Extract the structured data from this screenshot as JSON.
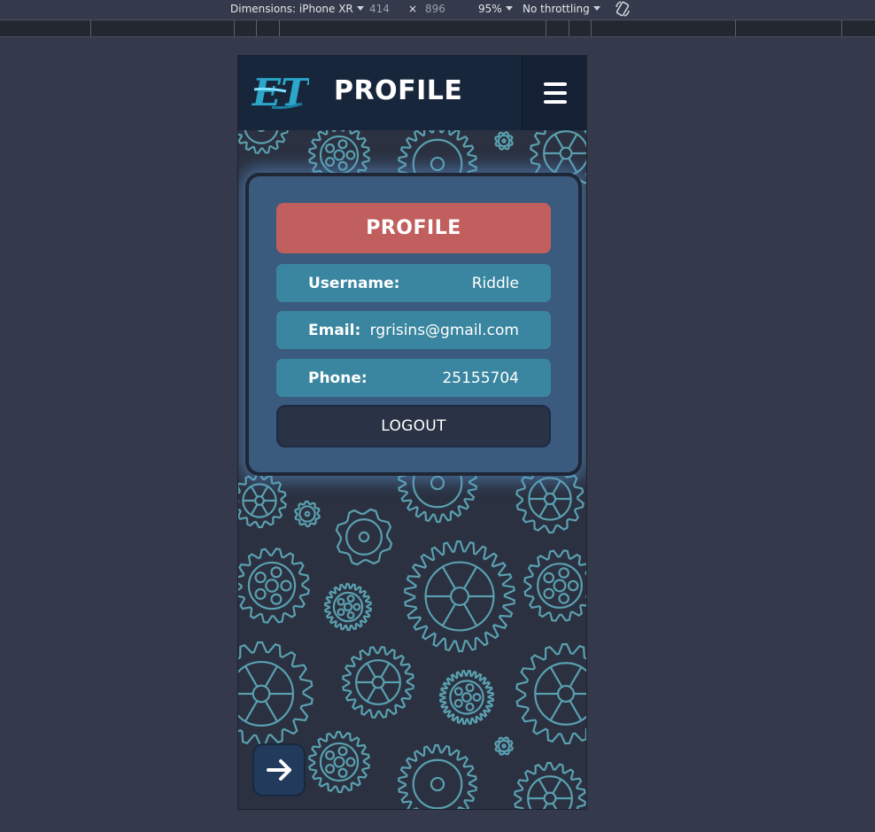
{
  "devtools": {
    "device_label": "Dimensions: iPhone XR",
    "width": "414",
    "times": "×",
    "height": "896",
    "zoom": "95%",
    "throttle": "No throttling"
  },
  "header": {
    "logo_text": "ET",
    "title": "PROFILE",
    "menu_icon": "hamburger-menu-icon"
  },
  "profile": {
    "title": "PROFILE",
    "fields": [
      {
        "label": "Username:",
        "value": "Riddle"
      },
      {
        "label": "Email:",
        "value": "rgrisins@gmail.com"
      },
      {
        "label": "Phone:",
        "value": "25155704"
      }
    ],
    "logout_label": "LOGOUT"
  },
  "fab": {
    "icon": "arrow-right-icon"
  },
  "colors": {
    "header_bg": "#17263b",
    "card_bg": "#3a5a7e",
    "title_bg": "#c15e5e",
    "field_bg": "#3a86a0",
    "gear_stroke": "#5aa0b0",
    "page_bg": "#343a4b"
  }
}
